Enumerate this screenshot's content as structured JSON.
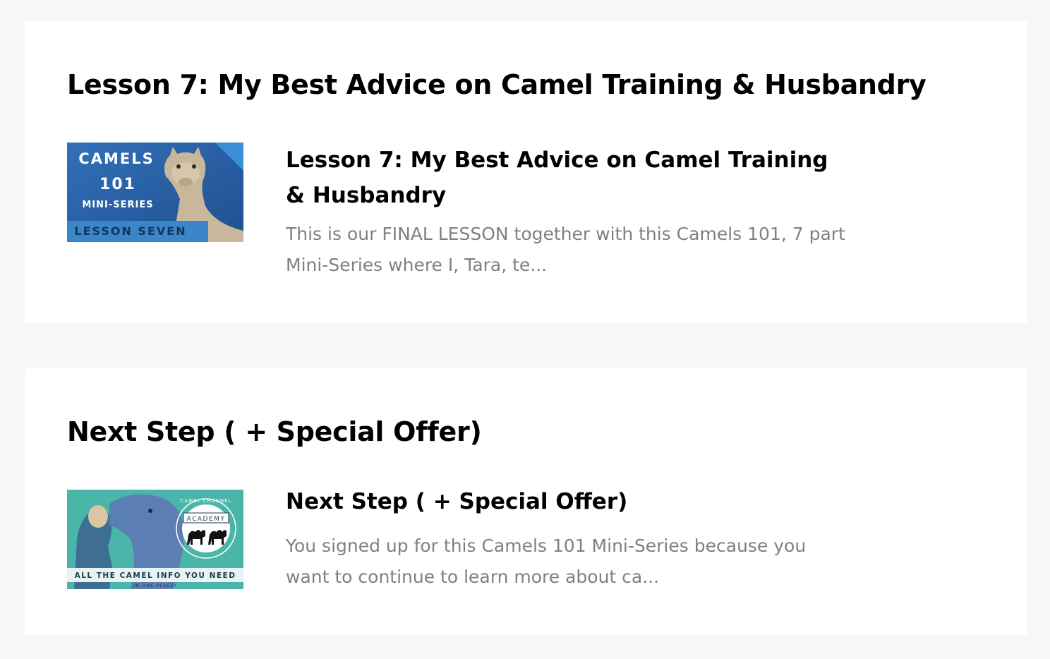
{
  "lessons": [
    {
      "section_title": "Lesson 7: My Best Advice on Camel Training & Husbandry",
      "title": "Lesson 7: My Best Advice on Camel Training & Husbandry",
      "description": "This is our FINAL LESSON together with this Camels 101, 7 part Mini-Series where I, Tara, te...",
      "thumbnail": {
        "line1": "CAMELS",
        "line2": "101",
        "line3": "MINI-SERIES",
        "banner": "LESSON SEVEN",
        "bg_color": "#2a63a8",
        "banner_color": "#3a86c8"
      }
    },
    {
      "section_title": "Next Step ( + Special Offer)",
      "title": "Next Step ( + Special Offer)",
      "description": "You signed up for this Camels 101 Mini-Series because you want to continue to learn more about ca...",
      "thumbnail": {
        "arc_text": "CAMEL CHANNEL",
        "badge": "ACADEMY",
        "banner": "ALL THE CAMEL INFO YOU NEED",
        "sub_banner": "IN ONE PLACE!",
        "bg_color": "#4cb5aa"
      }
    }
  ]
}
